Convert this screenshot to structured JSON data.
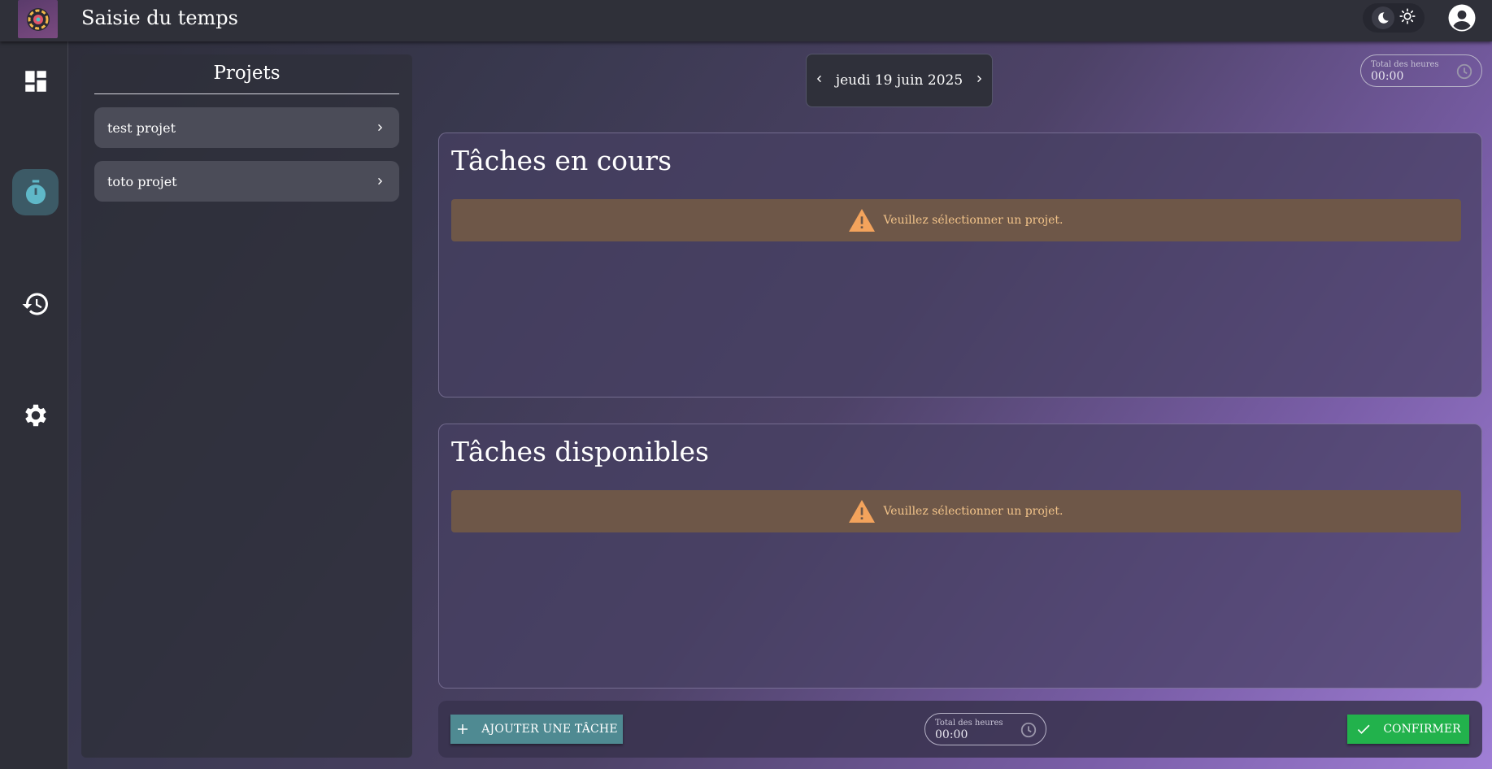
{
  "header": {
    "title": "Saisie du temps"
  },
  "nav": {
    "items": [
      {
        "icon": "dashboard-icon"
      },
      {
        "icon": "timer-icon",
        "active": true
      },
      {
        "icon": "history-icon"
      },
      {
        "icon": "gear-icon"
      }
    ]
  },
  "projects": {
    "title": "Projets",
    "items": [
      {
        "label": "test projet"
      },
      {
        "label": "toto projet"
      }
    ]
  },
  "date_nav": {
    "date": "jeudi 19 juin 2025"
  },
  "total_top": {
    "label": "Total des heures",
    "value": "00:00"
  },
  "current_tasks": {
    "title": "Tâches en cours",
    "warning": "Veuillez sélectionner un projet."
  },
  "available_tasks": {
    "title": "Tâches disponibles",
    "warning": "Veuillez sélectionner un projet."
  },
  "footer": {
    "add_task_label": "AJOUTER UNE TÂCHE",
    "total_label": "Total des heures",
    "total_value": "00:00",
    "confirm_label": "CONFIRMER"
  },
  "colors": {
    "accent_teal": "#4f8a92",
    "confirm_green": "#22b24c",
    "warning_text": "#f3c48a",
    "warning_icon": "#f3a35c"
  }
}
